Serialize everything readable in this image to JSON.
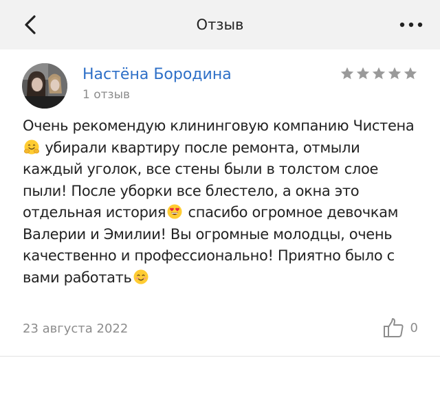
{
  "header": {
    "title": "Отзыв"
  },
  "review": {
    "author_name": "Настёна Бородина",
    "review_count": "1 отзыв",
    "rating": 5,
    "rating_max": 5,
    "text_parts": [
      "Очень рекомендую клининговую компанию Чистена",
      " убирали квартиру после ремонта, отмыли каждый уголок, все стены были в толстом слое пыли! После уборки все блестело, а окна это отдельная история",
      " спасибо огромное девочкам Валерии и Эмилии! Вы огромные молодцы, очень качественно и профессионально! Приятно было с вами работать"
    ],
    "emojis": [
      "hugging-face-emoji",
      "heart-eyes-emoji",
      "smiling-face-emoji"
    ],
    "date": "23 августа 2022",
    "likes": "0"
  },
  "icons": {
    "back": "chevron-left-icon",
    "more": "more-dots-icon",
    "star": "star-icon",
    "like": "thumbs-up-icon"
  },
  "colors": {
    "header_bg": "#f2f2f2",
    "author_link": "#2d6fc7",
    "secondary_text": "#8c8c8c",
    "star": "#9a9a9a",
    "body_text": "#222222"
  }
}
